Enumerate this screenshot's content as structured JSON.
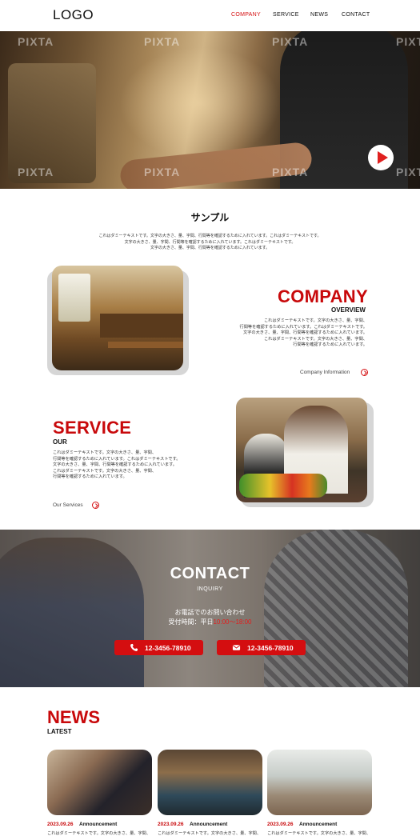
{
  "header": {
    "logo": "LOGO",
    "nav": [
      "COMPANY",
      "SERVICE",
      "NEWS",
      "CONTACT"
    ]
  },
  "hero": {
    "watermark": "PIXTA"
  },
  "sample": {
    "title": "サンプル",
    "lines": [
      "これはダミーテキストです。文字の大きさ、量、字間、行間等を確認するために入れています。これはダミーテキストです。",
      "文字の大きさ、量、字間、行間等を確認するために入れています。これはダミーテキストです。",
      "文字の大きさ、量、字間、行間等を確認するために入れています。"
    ]
  },
  "company": {
    "title": "COMPANY",
    "subtitle": "OVERVIEW",
    "lines": [
      "これはダミーテキストです。文字の大きさ、量、字間、",
      "行間等を確認するために入れています。これはダミーテキストです。",
      "文字の大きさ、量、字間、行間等を確認するために入れています。",
      "これはダミーテキストです。文字の大きさ、量、字間、",
      "行間等を確認するために入れています。"
    ],
    "link": "Company Information"
  },
  "service": {
    "title": "SERVICE",
    "subtitle": "OUR",
    "lines": [
      "これはダミーテキストです。文字の大きさ、量、字間、",
      "行間等を確認するために入れています。これはダミーテキストです。",
      "文字の大きさ、量、字間、行間等を確認するために入れています。",
      "これはダミーテキストです。文字の大きさ、量、字間、",
      "行間等を確認するために入れています。"
    ],
    "link": "Our Services"
  },
  "contact": {
    "title": "CONTACT",
    "subtitle": "INQUIRY",
    "phone_line": "お電話でのお問い合わせ",
    "hours_label": "受付時間：平日",
    "hours_value": "10:00～18:00",
    "phone_number": "12-3456-78910",
    "mail_number": "12-3456-78910"
  },
  "news": {
    "title": "NEWS",
    "subtitle": "LATEST",
    "items": [
      {
        "date": "2023.09.26",
        "category": "Announcement",
        "text": "これはダミーテキストです。文字の大きさ、量、字間、"
      },
      {
        "date": "2023.09.26",
        "category": "Announcement",
        "text": "これはダミーテキストです。文字の大きさ、量、字間、"
      },
      {
        "date": "2023.09.26",
        "category": "Announcement",
        "text": "これはダミーテキストです。文字の大きさ、量、字間、"
      }
    ]
  },
  "colors": {
    "accent": "#d40e10",
    "brand_red": "#c8090b"
  }
}
